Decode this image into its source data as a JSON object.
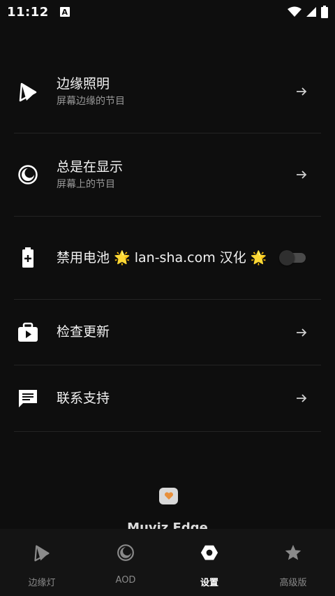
{
  "status_bar": {
    "time": "11:12",
    "notification_letter": "A"
  },
  "settings": [
    {
      "title": "边缘照明",
      "subtitle": "屏幕边缘的节目",
      "icon": "edge-lighting-icon",
      "control": "arrow"
    },
    {
      "title": "总是在显示",
      "subtitle": "屏幕上的节目",
      "icon": "aod-icon",
      "control": "arrow"
    },
    {
      "title": "禁用电池 🌟 lan-sha.com 汉化 🌟",
      "subtitle": "",
      "icon": "battery-icon",
      "control": "toggle",
      "toggle_on": false
    },
    {
      "title": "检查更新",
      "subtitle": "",
      "icon": "update-icon",
      "control": "arrow"
    },
    {
      "title": "联系支持",
      "subtitle": "",
      "icon": "support-chat-icon",
      "control": "arrow"
    }
  ],
  "footer": {
    "app_name": "Muviz Edge",
    "heart_color": "#e8903c"
  },
  "bottom_nav": [
    {
      "label": "边缘灯",
      "icon": "edge-lighting-icon",
      "active": false
    },
    {
      "label": "AOD",
      "icon": "aod-icon",
      "active": false
    },
    {
      "label": "设置",
      "icon": "settings-icon",
      "active": true
    },
    {
      "label": "高级版",
      "icon": "star-icon",
      "active": false
    }
  ],
  "colors": {
    "background": "#0e0e0e",
    "nav_background": "#141414",
    "divider": "#242424",
    "inactive": "#8a8a8a"
  }
}
